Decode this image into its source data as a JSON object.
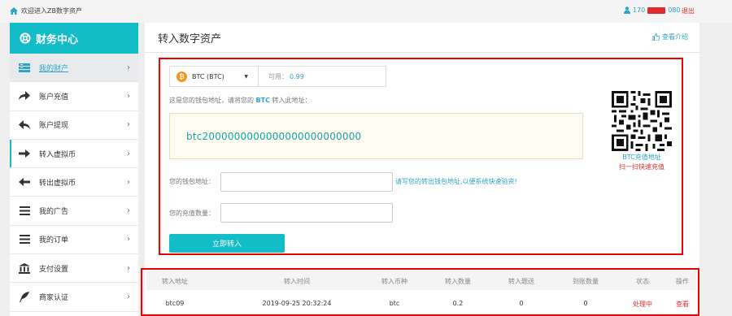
{
  "topbar": {
    "welcome": "欢迎进入ZB数字资产",
    "user_prefix": "170",
    "user_suffix": "080",
    "logout": "退出"
  },
  "sidebar": {
    "title": "财务中心",
    "items": [
      {
        "label": "我的财产",
        "icon": "wallet-icon",
        "active": true
      },
      {
        "label": "账户充值",
        "icon": "forward-arrow-icon"
      },
      {
        "label": "账户提现",
        "icon": "reply-arrow-icon"
      },
      {
        "label": "转入虚拟币",
        "icon": "right-arrow-icon",
        "current": true
      },
      {
        "label": "转出虚拟币",
        "icon": "left-arrow-icon"
      },
      {
        "label": "我的广告",
        "icon": "list-icon"
      },
      {
        "label": "我的订单",
        "icon": "list-icon"
      },
      {
        "label": "支付设置",
        "icon": "bank-icon"
      },
      {
        "label": "商家认证",
        "icon": "feather-icon"
      }
    ]
  },
  "page": {
    "title": "转入数字资产",
    "help": "查看介绍"
  },
  "deposit": {
    "coin_label": "BTC (BTC)",
    "available_label": "可用：",
    "available_value": "0.99",
    "hint_prefix": "这是您的钱包地址，请将您的",
    "hint_coin": "BTC",
    "hint_suffix": "转入此地址：",
    "address": "btc2000000000000000000000000",
    "qr_caption": "BTC充值地址",
    "qr_scan": "扫一扫快速充值",
    "wallet_label": "您的钱包地址：",
    "wallet_note": "请写您的转出钱包地址,以便系统快速验资!",
    "amount_label": "您的充值数量：",
    "submit": "立即转入"
  },
  "table": {
    "headers": [
      "转入地址",
      "转入时间",
      "转入币种",
      "转入数量",
      "转入题送",
      "到账数量",
      "状态",
      "操作"
    ],
    "rows": [
      [
        "btc09",
        "2019-09-25 20:32:24",
        "btc",
        "0.2",
        "0",
        "0",
        "处理中",
        "查看"
      ]
    ]
  },
  "colors": {
    "accent": "#12bdc8",
    "link": "#2aa5c9",
    "alert": "#e02c2c"
  }
}
